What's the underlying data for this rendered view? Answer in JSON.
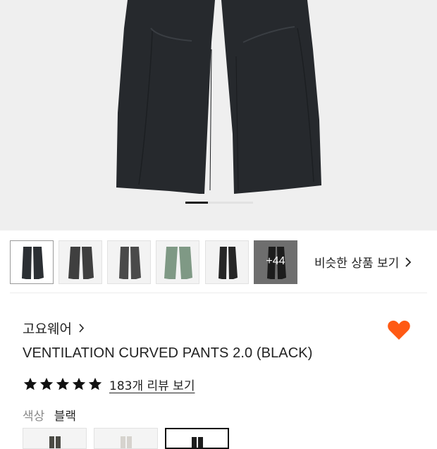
{
  "gallery": {
    "current_image": 1,
    "total_images": 3
  },
  "thumbnails": [
    {
      "color": "#2b2f33"
    },
    {
      "color": "#3f3f3f"
    },
    {
      "color": "#4a4a4a"
    },
    {
      "color": "#7f9985"
    },
    {
      "color": "#262626"
    },
    {
      "color": "#1c1c1c",
      "overlay_label": "+44"
    }
  ],
  "similar_products": {
    "label": "비슷한 상품 보기",
    "icon": "chevron-right-icon"
  },
  "product": {
    "brand": "고요웨어",
    "name": "VENTILATION CURVED PANTS 2.0 (BLACK)",
    "rating_stars": 5,
    "review_link": "183개 리뷰 보기",
    "liked": true,
    "like_color": "#ff5a14"
  },
  "color_option": {
    "label": "색상",
    "selected": "블랙",
    "swatches": [
      {
        "color": "#4a4a44"
      },
      {
        "color": "#d6d3ce"
      },
      {
        "color": "#1c1c1c",
        "selected": true
      }
    ]
  }
}
